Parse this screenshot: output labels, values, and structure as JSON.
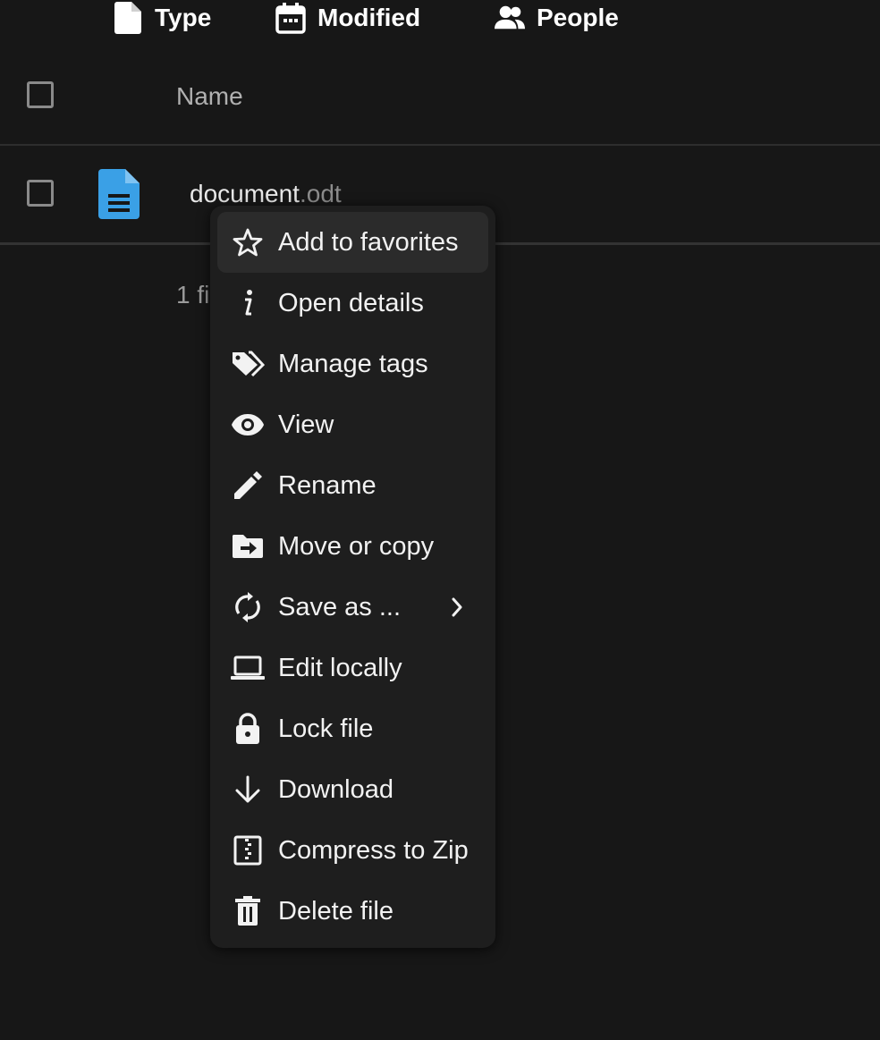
{
  "filters": {
    "type_label": "Type",
    "modified_label": "Modified",
    "people_label": "People"
  },
  "table": {
    "name_header": "Name",
    "file": {
      "basename": "document",
      "extension": ".odt",
      "icon": "document-icon",
      "icon_color": "#3aa0e6"
    },
    "summary": "1 fi"
  },
  "context_menu": {
    "items": [
      {
        "label": "Add to favorites",
        "icon": "star-icon"
      },
      {
        "label": "Open details",
        "icon": "info-icon"
      },
      {
        "label": "Manage tags",
        "icon": "tags-icon"
      },
      {
        "label": "View",
        "icon": "eye-icon"
      },
      {
        "label": "Rename",
        "icon": "pencil-icon"
      },
      {
        "label": "Move or copy",
        "icon": "folder-move-icon"
      },
      {
        "label": "Save as ...",
        "icon": "sync-icon"
      },
      {
        "label": "Edit locally",
        "icon": "laptop-icon"
      },
      {
        "label": "Lock file",
        "icon": "lock-icon"
      },
      {
        "label": "Download",
        "icon": "arrow-down-icon"
      },
      {
        "label": "Compress to Zip",
        "icon": "zip-icon"
      },
      {
        "label": "Delete file",
        "icon": "trash-icon"
      }
    ]
  },
  "colors": {
    "background": "#171717",
    "menu_background": "#1e1e1e",
    "menu_hover": "#2b2b2b",
    "accent": "#3aa0e6"
  }
}
